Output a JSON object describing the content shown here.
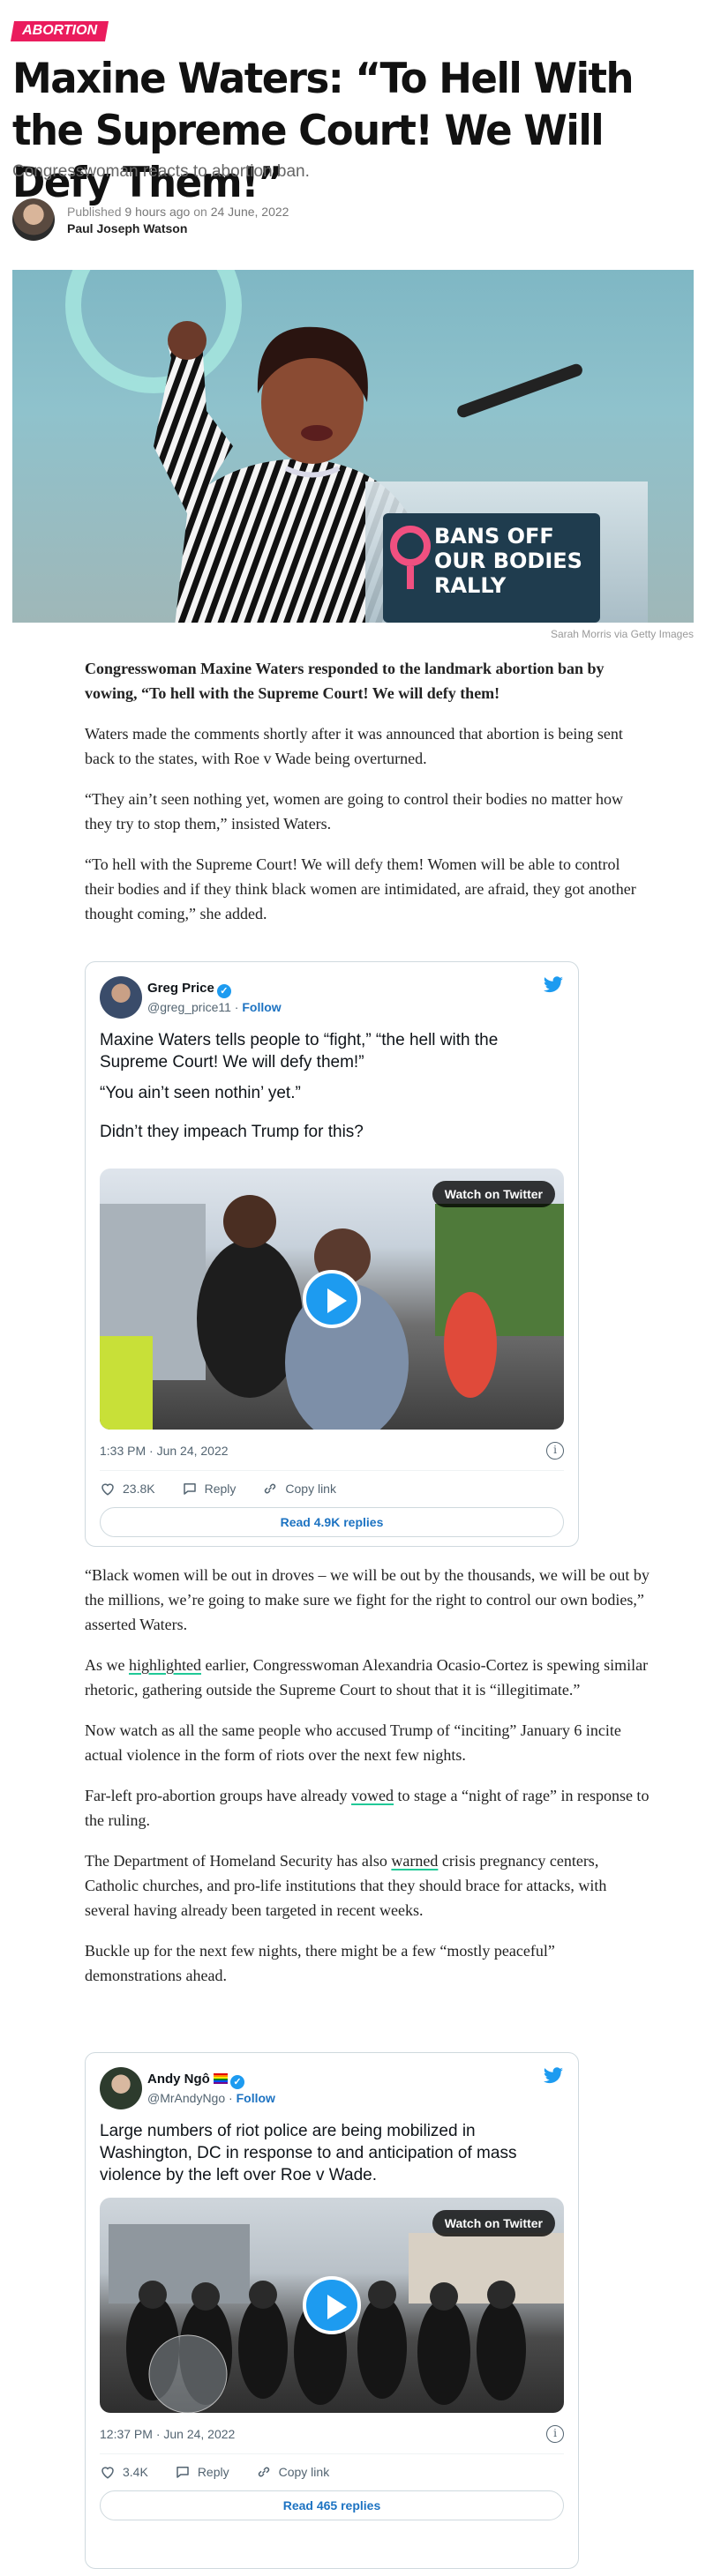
{
  "category": "ABORTION",
  "title": "Maxine Waters: “To Hell With the Supreme Court! We Will Defy Them!”",
  "subtitle": "Congresswoman reacts to abortion ban.",
  "byline": {
    "published_label": "Published",
    "relative_time": "9 hours ago",
    "on_label": "on",
    "date": "24 June, 2022",
    "author": "Paul Joseph Watson"
  },
  "hero": {
    "sign_text": "BANS OFF OUR BODIES RALLY",
    "credit": "Sarah Morris via Getty Images"
  },
  "article": {
    "lead": "Congresswoman Maxine Waters responded to the landmark abortion ban by vowing, “To hell with the Supreme Court! We will defy them!",
    "p1": "Waters made the comments shortly after it was announced that abortion is being sent back to the states, with Roe v Wade being overturned.",
    "p2": "“They ain’t seen nothing yet, women are going to control their bodies no matter how they try to stop them,” insisted Waters.",
    "p3": "“To hell with the Supreme Court! We will defy them! Women will be able to control their bodies and if they think black women are intimidated, are afraid, they got another thought coming,” she added.",
    "p4": "“Black women will be out in droves – we will be out by the thousands, we will be out by the millions, we’re going to make sure we fight for the right to control our own bodies,” asserted Waters.",
    "p5_pre": "As we ",
    "p5_link": "highlighted",
    "p5_post": " earlier, Congresswoman Alexandria Ocasio-Cortez is spewing similar rhetoric, gathering outside the Supreme Court to shout that it is “illegitimate.”",
    "p6": "Now watch as all the same people who accused Trump of “inciting” January 6 incite actual violence in the form of riots over the next few nights.",
    "p7_pre": "Far-left pro-abortion groups have already ",
    "p7_link": "vowed",
    "p7_post": " to stage a “night of rage” in response to the ruling.",
    "p8_pre": "The Department of Homeland Security has also ",
    "p8_link": "warned",
    "p8_post": " crisis pregnancy centers, Catholic churches, and pro-life institutions that they should brace for attacks, with several having already been targeted in recent weeks.",
    "p9": "Buckle up for the next few nights, there might be a few “mostly peaceful” demonstrations ahead."
  },
  "tweets": [
    {
      "name": "Greg Price",
      "handle": "@greg_price11",
      "sep": "·",
      "follow": "Follow",
      "text1": "Maxine Waters tells people to “fight,” “the hell with the Supreme Court! We will defy them!”",
      "text2": "“You ain’t seen nothin’ yet.”",
      "text3": "Didn’t they impeach Trump for this?",
      "watch": "Watch on Twitter",
      "time": "1:33 PM · Jun 24, 2022",
      "likes": "23.8K",
      "reply": "Reply",
      "copy": "Copy link",
      "read": "Read 4.9K replies"
    },
    {
      "name": "Andy Ngô",
      "handle": "@MrAndyNgo",
      "sep": "·",
      "follow": "Follow",
      "text1": "Large numbers of riot police are being mobilized in Washington, DC in response to and anticipation of mass violence by the left over Roe v Wade.",
      "watch": "Watch on Twitter",
      "time": "12:37 PM · Jun 24, 2022",
      "likes": "3.4K",
      "reply": "Reply",
      "copy": "Copy link",
      "read": "Read 465 replies"
    }
  ],
  "colors": {
    "tag": "#ea1c5d",
    "twitter": "#1d9bf0",
    "link": "#1d73c2",
    "highlight": "#20c997"
  }
}
